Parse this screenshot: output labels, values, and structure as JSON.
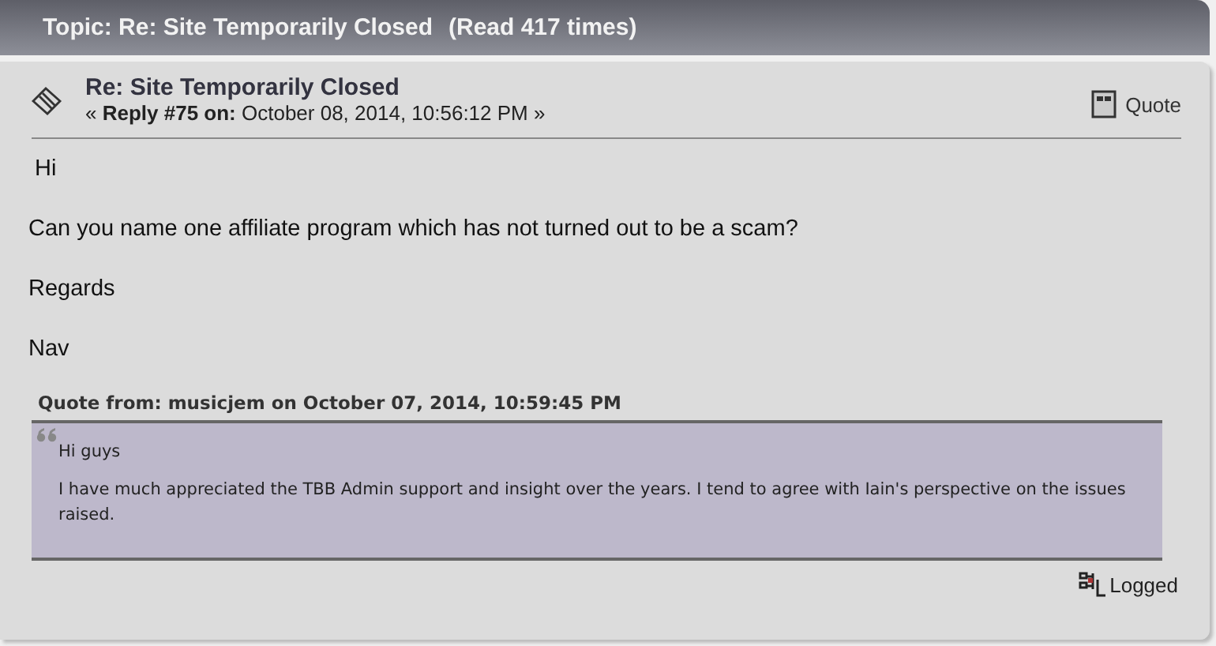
{
  "topic_bar": {
    "title": "Topic: Re: Site Temporarily Closed",
    "read_count": "(Read 417 times)"
  },
  "post": {
    "subject": "Re: Site Temporarily Closed",
    "reply_info": "« **Reply #75 on:** October 08, 2014, 10:56:12 PM »",
    "quote_button": "Quote",
    "paragraphs": [
      "Hi",
      "Can you name one affiliate program which has not turned out to be a scam?",
      "Regards",
      "Nav"
    ],
    "quote": {
      "header": "Quote from: musicjem on October 07, 2014, 10:59:45 PM",
      "paragraphs": [
        "Hi guys",
        "I have much appreciated the TBB Admin support and insight over the years. I tend to agree with Iain's perspective on the issues raised."
      ]
    },
    "logged": "Logged"
  }
}
